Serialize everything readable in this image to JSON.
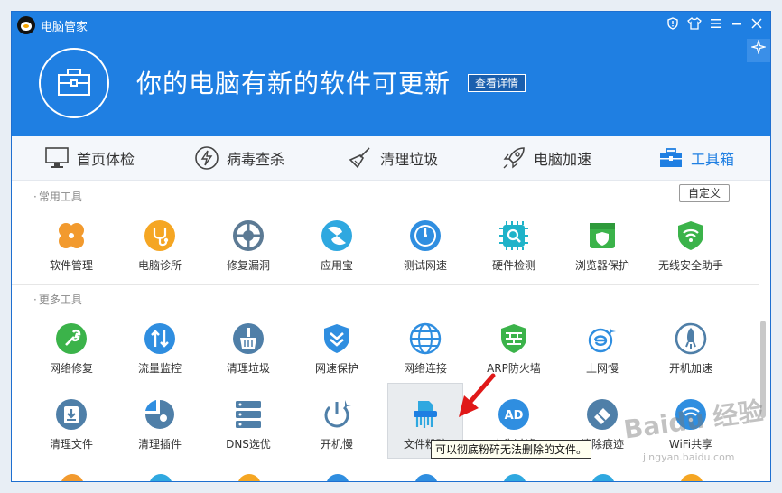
{
  "window": {
    "title": "电脑管家"
  },
  "hero": {
    "message": "你的电脑有新的软件可更新",
    "details_label": "查看详情"
  },
  "tabs": [
    {
      "label": "首页体检"
    },
    {
      "label": "病毒查杀"
    },
    {
      "label": "清理垃圾"
    },
    {
      "label": "电脑加速"
    },
    {
      "label": "工具箱"
    }
  ],
  "common_tools": {
    "title": "常用工具",
    "customize_label": "自定义",
    "items": [
      {
        "label": "软件管理",
        "icon": "software-manager-icon"
      },
      {
        "label": "电脑诊所",
        "icon": "computer-clinic-icon"
      },
      {
        "label": "修复漏洞",
        "icon": "fix-vulnerability-icon"
      },
      {
        "label": "应用宝",
        "icon": "app-store-icon"
      },
      {
        "label": "测试网速",
        "icon": "speed-test-icon"
      },
      {
        "label": "硬件检测",
        "icon": "hardware-check-icon"
      },
      {
        "label": "浏览器保护",
        "icon": "browser-protect-icon"
      },
      {
        "label": "无线安全助手",
        "icon": "wifi-security-icon"
      }
    ]
  },
  "more_tools": {
    "title": "更多工具",
    "row1": [
      {
        "label": "网络修复",
        "icon": "network-repair-icon"
      },
      {
        "label": "流量监控",
        "icon": "traffic-monitor-icon"
      },
      {
        "label": "清理垃圾",
        "icon": "cleanup-icon"
      },
      {
        "label": "网速保护",
        "icon": "speed-protect-icon"
      },
      {
        "label": "网络连接",
        "icon": "network-connection-icon"
      },
      {
        "label": "ARP防火墙",
        "icon": "arp-firewall-icon"
      },
      {
        "label": "上网慢",
        "icon": "slow-internet-icon"
      },
      {
        "label": "开机加速",
        "icon": "boot-speedup-icon"
      }
    ],
    "row2": [
      {
        "label": "清理文件",
        "icon": "clean-files-icon"
      },
      {
        "label": "清理插件",
        "icon": "clean-plugins-icon"
      },
      {
        "label": "DNS选优",
        "icon": "dns-optimize-icon"
      },
      {
        "label": "开机慢",
        "icon": "slow-boot-icon"
      },
      {
        "label": "文件粉碎",
        "icon": "file-shredder-icon"
      },
      {
        "label": "广告过滤",
        "icon": "ad-filter-icon"
      },
      {
        "label": "清除痕迹",
        "icon": "clear-traces-icon"
      },
      {
        "label": "WiFi共享",
        "icon": "wifi-share-icon"
      }
    ]
  },
  "tooltip": {
    "text": "可以彻底粉碎无法删除的文件。"
  },
  "watermark": {
    "text": "Baidu 经验",
    "url": "jingyan.baidu.com"
  },
  "colors": {
    "header": "#1f7fe2",
    "accent": "#1f7fe2"
  }
}
